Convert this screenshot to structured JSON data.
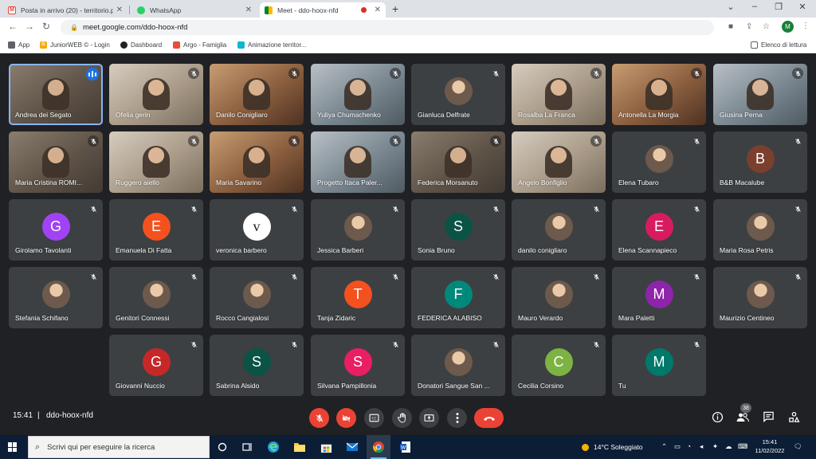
{
  "browser": {
    "tabs": [
      {
        "title": "Posta in arrivo (20) - territorio.pa",
        "icon": "gmail-icon",
        "active": false
      },
      {
        "title": "WhatsApp",
        "icon": "whatsapp-icon",
        "active": false
      },
      {
        "title": "Meet - ddo-hoox-nfd",
        "icon": "meet-icon",
        "active": true
      }
    ],
    "url": "meet.google.com/ddo-hoox-nfd",
    "profile_initial": "M",
    "bookmarks": [
      {
        "label": "App",
        "icon": "apps-grid-icon"
      },
      {
        "label": "JuniorWEB © - Login",
        "icon": "juniorweb-icon"
      },
      {
        "label": "Dashboard",
        "icon": "dashboard-icon"
      },
      {
        "label": "Argo - Famiglia",
        "icon": "argo-icon"
      },
      {
        "label": "Animazione territor...",
        "icon": "animazione-icon"
      }
    ],
    "reading_list_label": "Elenco di lettura"
  },
  "meet": {
    "time": "15:41",
    "separator": "|",
    "code": "ddo-hoox-nfd",
    "participant_count": "38",
    "participants": [
      {
        "name": "Andrea dei Segato",
        "kind": "video",
        "speaking": true
      },
      {
        "name": "Ofelia gerin",
        "kind": "video"
      },
      {
        "name": "Danilo Conigliaro",
        "kind": "video"
      },
      {
        "name": "Yuliya Chumachenko",
        "kind": "video"
      },
      {
        "name": "Gianluca Delfrate",
        "kind": "photo"
      },
      {
        "name": "Rosalba La Franca",
        "kind": "video"
      },
      {
        "name": "Antonella La Morgia",
        "kind": "video"
      },
      {
        "name": "Giusina Perna",
        "kind": "video"
      },
      {
        "name": "Maria Cristina ROMI...",
        "kind": "video"
      },
      {
        "name": "Ruggero aiello",
        "kind": "video"
      },
      {
        "name": "Maria Savarino",
        "kind": "video"
      },
      {
        "name": "Progetto Itaca Paler...",
        "kind": "video"
      },
      {
        "name": "Federica Morsanuto",
        "kind": "video"
      },
      {
        "name": "Angelo Bonfiglio",
        "kind": "video"
      },
      {
        "name": "Elena Tubaro",
        "kind": "photo"
      },
      {
        "name": "B&B Macalube",
        "kind": "letter",
        "letter": "B",
        "color": "#7b3f2e"
      },
      {
        "name": "Girolamo Tavolanti",
        "kind": "letter",
        "letter": "G",
        "color": "#a142f4"
      },
      {
        "name": "Emanuela Di Fatta",
        "kind": "letter",
        "letter": "E",
        "color": "#f4511e"
      },
      {
        "name": "veronica barbero",
        "kind": "letter-white",
        "letter": "v",
        "color": "#ffffff"
      },
      {
        "name": "Jessica Barberi",
        "kind": "photo"
      },
      {
        "name": "Sonia Bruno",
        "kind": "letter",
        "letter": "S",
        "color": "#0b5345"
      },
      {
        "name": "danilo conigliaro",
        "kind": "photo"
      },
      {
        "name": "Elena Scannapieco",
        "kind": "letter",
        "letter": "E",
        "color": "#d81b60"
      },
      {
        "name": "Maria Rosa Petris",
        "kind": "photo"
      },
      {
        "name": "Stefania Schifano",
        "kind": "photo"
      },
      {
        "name": "Genitori Connessi",
        "kind": "photo"
      },
      {
        "name": "Rocco Cangialosi",
        "kind": "photo"
      },
      {
        "name": "Tanja Zidaric",
        "kind": "letter",
        "letter": "T",
        "color": "#f4511e"
      },
      {
        "name": "FEDERICA ALABISO",
        "kind": "letter",
        "letter": "F",
        "color": "#00897b"
      },
      {
        "name": "Mauro Verardo",
        "kind": "photo"
      },
      {
        "name": "Mara Paletti",
        "kind": "letter",
        "letter": "M",
        "color": "#8e24aa"
      },
      {
        "name": "Maurizio Centineo",
        "kind": "photo"
      },
      {
        "name": "Giovanni Nuccio",
        "kind": "letter",
        "letter": "G",
        "color": "#c62828"
      },
      {
        "name": "Sabrina Alsido",
        "kind": "letter",
        "letter": "S",
        "color": "#0b5345"
      },
      {
        "name": "Silvana Pampillonia",
        "kind": "letter",
        "letter": "S",
        "color": "#e91e63"
      },
      {
        "name": "Donatori Sangue San ...",
        "kind": "photo"
      },
      {
        "name": "Cecilia Corsino",
        "kind": "letter",
        "letter": "C",
        "color": "#7cb342"
      },
      {
        "name": "Tu",
        "kind": "letter",
        "letter": "M",
        "color": "#00796b"
      }
    ],
    "controls": [
      {
        "name": "mic-toggle-button",
        "icon": "mic-off-icon",
        "state": "off"
      },
      {
        "name": "camera-toggle-button",
        "icon": "camera-off-icon",
        "state": "off"
      },
      {
        "name": "captions-button",
        "icon": "captions-icon"
      },
      {
        "name": "raise-hand-button",
        "icon": "hand-icon"
      },
      {
        "name": "present-button",
        "icon": "present-screen-icon"
      },
      {
        "name": "more-options-button",
        "icon": "more-vertical-icon"
      },
      {
        "name": "leave-call-button",
        "icon": "phone-hangup-icon"
      }
    ],
    "right_controls": [
      {
        "name": "meeting-details-button",
        "icon": "info-icon"
      },
      {
        "name": "people-button",
        "icon": "people-icon"
      },
      {
        "name": "chat-button",
        "icon": "chat-icon"
      },
      {
        "name": "activities-button",
        "icon": "activities-icon"
      }
    ],
    "colors": {
      "background": "#202124",
      "tile": "#3c4043",
      "danger": "#ea4335",
      "speaking": "#1a73e8"
    }
  },
  "taskbar": {
    "search_placeholder": "Scrivi qui per eseguire la ricerca",
    "apps": [
      "task-view-icon",
      "edge-icon",
      "file-explorer-icon",
      "store-icon",
      "mail-icon",
      "chrome-icon",
      "word-icon"
    ],
    "weather": "14°C  Soleggiato",
    "clock_time": "15:41",
    "clock_date": "11/02/2022"
  }
}
